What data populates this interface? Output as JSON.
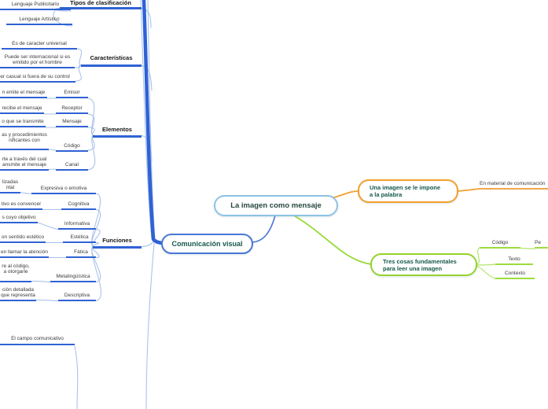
{
  "center": {
    "root_label": "La imagen como mensaje"
  },
  "left": {
    "root_label": "Comunicación visual",
    "sections": [
      {
        "label": "Tipos de clasificación",
        "items": [
          {
            "text": "Lenguaje Publicitario"
          },
          {
            "text": "Lenguaje Artistico"
          }
        ]
      },
      {
        "label": "Características",
        "items": [
          {
            "text": "Es de caracter universal"
          },
          {
            "text": "Puede ser internacional si es\nemitido por el hombre"
          },
          {
            "text": "ser casual si fuera de su control"
          }
        ]
      },
      {
        "label": "Elementos",
        "items": [
          {
            "keyword": "Emisor",
            "desc": "n emite el mensaje"
          },
          {
            "keyword": "Receptor",
            "desc": "recibe el mensaje"
          },
          {
            "keyword": "Mensaje",
            "desc": "o que se transmite"
          },
          {
            "keyword": "Código",
            "desc": "as y procedimientos\nnificantes con"
          },
          {
            "keyword": "Canal",
            "desc": "rte a través del cual\nansmite el mensaje"
          }
        ]
      },
      {
        "label": "Funciones",
        "items": [
          {
            "keyword": "Expresiva o emotiva",
            "desc": "lizadas\nntal"
          },
          {
            "keyword": "Cognitiva",
            "desc": "tivo es convencer"
          },
          {
            "keyword": "Informativa",
            "desc": "s cuyo objetivo"
          },
          {
            "keyword": "Estética",
            "desc": "on sentido estético"
          },
          {
            "keyword": "Fática",
            "desc": "en llamar la atención"
          },
          {
            "keyword": "Metalingüística",
            "desc": "re al código,\na otorgarle"
          },
          {
            "keyword": "Descriptiva",
            "desc": "ción detallada\nque representa"
          }
        ]
      }
    ],
    "bottom_item": "El campo comunicativo"
  },
  "right": {
    "orange_branch": {
      "label": "Una imagen se le impone\na la palabra",
      "child": "En material de comunicación"
    },
    "green_branch": {
      "label": "Tres cosas fundamentales\npara leer una imagen",
      "children": [
        {
          "text": "Código",
          "child": "Pe"
        },
        {
          "text": "Texto"
        },
        {
          "text": "Contexto"
        }
      ]
    }
  },
  "colors": {
    "branch_blue": "#2f62d4",
    "branch_blue_light": "#aac2ec",
    "branch_orange": "#f2a02d",
    "branch_green": "#97d935",
    "node_text_green": "#14584a",
    "small_text": "#3b3b3b"
  }
}
